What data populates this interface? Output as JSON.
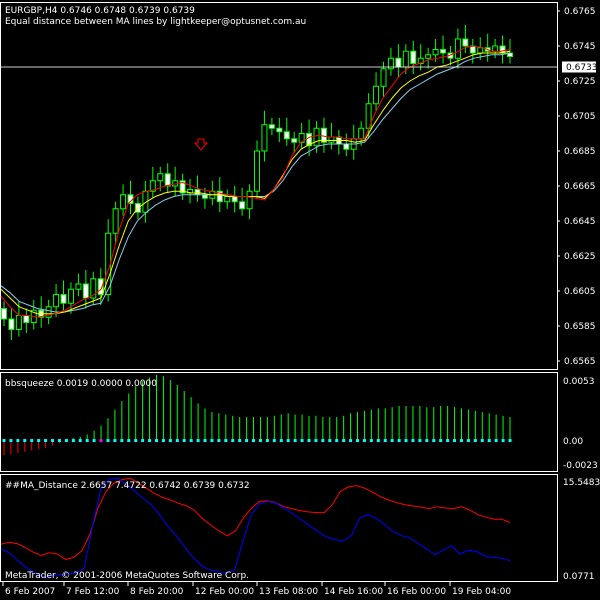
{
  "header": {
    "symbol_line": "EURGBP,H4  0.6746 0.6748 0.6739 0.6739",
    "indicator_line": "Equal distance between MA lines by lightkeeper@optusnet.com.au",
    "arrow_icon": "down-arrow-icon"
  },
  "main_panel": {
    "price_axis": [
      "0.6765",
      "0.6745",
      "0.6725",
      "0.6705",
      "0.6685",
      "0.6665",
      "0.6645",
      "0.6625",
      "0.6605",
      "0.6585",
      "0.6565"
    ],
    "current_price": "0.6733",
    "ylim": [
      0.6561,
      0.6769
    ]
  },
  "bbsqueeze_panel": {
    "label": "bbsqueeze 0.0019 0.0000 0.0000",
    "axis": [
      "0.0053",
      "0.00",
      "-0.0023"
    ]
  },
  "ma_distance_panel": {
    "label": "##MA_Distance 2.6657 7.4722 0.6742 0.6739 0.6732",
    "axis_top": "15.5483",
    "axis_bottom": "0.0771"
  },
  "copyright": "MetaTrader, © 2001-2006 MetaQuotes Software Corp.",
  "time_axis": [
    "6 Feb 2007",
    "7 Feb 12:00",
    "8 Feb 20:00",
    "12 Feb 00:00",
    "13 Feb 08:00",
    "14 Feb 16:00",
    "16 Feb 00:00",
    "19 Feb 04:00"
  ],
  "colors": {
    "background": "#000000",
    "grid": "#ffffff",
    "candle_up": "#00ff00",
    "candle_up_body": "#000000",
    "candle_down_body": "#ffffff",
    "ma_fast": "#ff0000",
    "ma_mid": "#ffff00",
    "ma_slow": "#87ceeb",
    "squeeze_pos": "#00ff00",
    "squeeze_neg": "#ff0000",
    "squeeze_dot": "#00ffff",
    "dist_red": "#ff0000",
    "dist_blue": "#0000ff"
  },
  "chart_data": {
    "type": "line",
    "candles_close": [
      0.6589,
      0.6583,
      0.6591,
      0.6587,
      0.6594,
      0.659,
      0.6596,
      0.6603,
      0.6598,
      0.6606,
      0.6609,
      0.6601,
      0.6612,
      0.6603,
      0.6638,
      0.6652,
      0.666,
      0.6655,
      0.665,
      0.6662,
      0.6668,
      0.6672,
      0.6665,
      0.6668,
      0.6661,
      0.6663,
      0.666,
      0.6658,
      0.6662,
      0.6656,
      0.6659,
      0.6656,
      0.6652,
      0.6662,
      0.6685,
      0.67,
      0.6698,
      0.6696,
      0.6692,
      0.669,
      0.6695,
      0.6688,
      0.6698,
      0.669,
      0.6693,
      0.6689,
      0.6686,
      0.6692,
      0.6698,
      0.6712,
      0.6722,
      0.6732,
      0.6738,
      0.6733,
      0.6742,
      0.6735,
      0.6738,
      0.674,
      0.6743,
      0.6741,
      0.6738,
      0.6749,
      0.6745,
      0.6741,
      0.6744,
      0.6742,
      0.6745,
      0.6741,
      0.6739
    ],
    "ma_fast": [
      0.6602,
      0.6596,
      0.6591,
      0.6591,
      0.659,
      0.6591,
      0.6592,
      0.6594,
      0.6597,
      0.66,
      0.6602,
      0.6606,
      0.662,
      0.664,
      0.6655,
      0.666,
      0.6662,
      0.6663,
      0.6665,
      0.6666,
      0.6667,
      0.6665,
      0.6663,
      0.6662,
      0.6661,
      0.666,
      0.6659,
      0.6659,
      0.6658,
      0.6657,
      0.6663,
      0.667,
      0.6682,
      0.669,
      0.6693,
      0.6694,
      0.6693,
      0.6693,
      0.6692,
      0.6692,
      0.6692,
      0.6705,
      0.6715,
      0.6722,
      0.6729,
      0.6733,
      0.6735,
      0.6737,
      0.6738,
      0.6739,
      0.6741,
      0.6744,
      0.6745,
      0.6744,
      0.6742,
      0.6742,
      0.6743
    ],
    "ma_mid": [
      0.6606,
      0.6601,
      0.6596,
      0.6594,
      0.6592,
      0.6592,
      0.6592,
      0.6593,
      0.6595,
      0.6597,
      0.6599,
      0.6601,
      0.6615,
      0.6631,
      0.6645,
      0.6652,
      0.6656,
      0.6659,
      0.6661,
      0.6662,
      0.6662,
      0.6661,
      0.6661,
      0.666,
      0.666,
      0.6659,
      0.6659,
      0.6659,
      0.6659,
      0.6658,
      0.6663,
      0.6671,
      0.668,
      0.6686,
      0.6689,
      0.6691,
      0.6691,
      0.6691,
      0.6691,
      0.669,
      0.6691,
      0.67,
      0.6708,
      0.6715,
      0.6721,
      0.6725,
      0.6728,
      0.673,
      0.6733,
      0.6734,
      0.6736,
      0.6738,
      0.674,
      0.6741,
      0.6741,
      0.6741,
      0.6742
    ],
    "ma_slow": [
      0.6608,
      0.6604,
      0.6599,
      0.6597,
      0.6595,
      0.6594,
      0.6593,
      0.6593,
      0.6594,
      0.6595,
      0.6597,
      0.6598,
      0.6608,
      0.6623,
      0.6636,
      0.6645,
      0.665,
      0.6654,
      0.6657,
      0.6659,
      0.666,
      0.666,
      0.666,
      0.666,
      0.666,
      0.666,
      0.6659,
      0.6659,
      0.6659,
      0.6659,
      0.6662,
      0.6668,
      0.6676,
      0.6682,
      0.6685,
      0.6688,
      0.6689,
      0.6689,
      0.6689,
      0.6689,
      0.669,
      0.6696,
      0.6703,
      0.6709,
      0.6715,
      0.672,
      0.6723,
      0.6726,
      0.6729,
      0.6731,
      0.6733,
      0.6736,
      0.6738,
      0.6739,
      0.674,
      0.674,
      0.6741
    ],
    "squeeze": [
      -0.0012,
      -0.0011,
      -0.001,
      -0.0009,
      -0.0008,
      -0.0007,
      -0.0006,
      -0.0004,
      -0.0002,
      0.0001,
      0.0002,
      0.0003,
      0.0005,
      0.0008,
      0.0012,
      0.0018,
      0.0025,
      0.0032,
      0.0038,
      0.0044,
      0.0048,
      0.0051,
      0.0053,
      0.0052,
      0.0049,
      0.0045,
      0.004,
      0.0035,
      0.003,
      0.0026,
      0.0023,
      0.0022,
      0.0021,
      0.002,
      0.0019,
      0.0019,
      0.0019,
      0.0019,
      0.0019,
      0.002,
      0.0021,
      0.0022,
      0.0021,
      0.0021,
      0.002,
      0.002,
      0.0019,
      0.0019,
      0.0019,
      0.002,
      0.0022,
      0.0023,
      0.0024,
      0.0025,
      0.0026,
      0.0026,
      0.0027,
      0.0028,
      0.0028,
      0.0028,
      0.0028,
      0.0027,
      0.0027,
      0.0028,
      0.0028,
      0.0027,
      0.0026,
      0.0025,
      0.0024,
      0.0023,
      0.0022,
      0.0021,
      0.002,
      0.0019
    ],
    "dist_red": [
      5.5,
      5.8,
      5.6,
      5.0,
      4.3,
      3.8,
      4.2,
      4.0,
      3.2,
      3.5,
      4.5,
      7.0,
      11.0,
      13.5,
      14.8,
      15.3,
      15.5,
      14.8,
      14.0,
      13.2,
      12.6,
      12.2,
      11.7,
      11.3,
      10.6,
      9.3,
      8.4,
      7.5,
      6.8,
      7.5,
      9.5,
      11.0,
      12.0,
      12.1,
      11.8,
      11.2,
      10.9,
      10.6,
      10.4,
      10.3,
      10.3,
      11.5,
      13.5,
      14.2,
      14.4,
      14.0,
      13.4,
      12.7,
      12.2,
      11.8,
      11.5,
      11.3,
      11.1,
      10.9,
      11.2,
      11.0,
      10.9,
      11.2,
      10.7,
      10.0,
      9.6,
      9.3,
      9.3,
      8.8
    ],
    "dist_blue": [
      4.8,
      4.2,
      3.0,
      2.0,
      1.2,
      0.6,
      0.7,
      0.9,
      1.0,
      1.1,
      1.9,
      8.5,
      14.0,
      15.4,
      15.5,
      14.6,
      13.6,
      12.5,
      11.5,
      10.0,
      8.2,
      6.8,
      5.1,
      3.5,
      2.3,
      1.6,
      1.3,
      1.2,
      1.6,
      6.0,
      10.0,
      11.7,
      12.0,
      11.7,
      10.9,
      10.1,
      9.2,
      8.3,
      7.4,
      6.6,
      6.2,
      6.0,
      6.8,
      9.5,
      10.0,
      9.4,
      8.5,
      7.4,
      6.8,
      6.5,
      5.6,
      4.8,
      3.9,
      4.6,
      5.3,
      4.0,
      4.6,
      4.4,
      3.7,
      3.5,
      3.4,
      3.0
    ],
    "dist_ylim": [
      0.0771,
      15.5483
    ]
  }
}
